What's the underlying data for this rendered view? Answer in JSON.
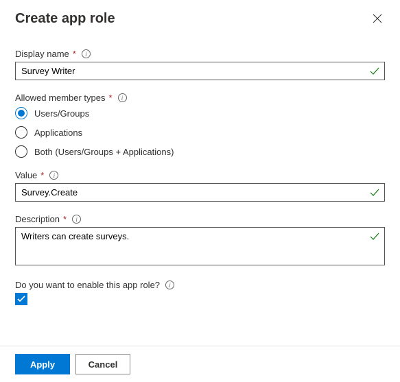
{
  "title": "Create app role",
  "fields": {
    "display_name": {
      "label": "Display name",
      "value": "Survey Writer"
    },
    "allowed_member_types": {
      "label": "Allowed member types",
      "options": [
        "Users/Groups",
        "Applications",
        "Both (Users/Groups + Applications)"
      ],
      "selected_index": 0
    },
    "value": {
      "label": "Value",
      "value": "Survey.Create"
    },
    "description": {
      "label": "Description",
      "value": "Writers can create surveys."
    },
    "enable": {
      "label": "Do you want to enable this app role?",
      "checked": true
    }
  },
  "buttons": {
    "apply": "Apply",
    "cancel": "Cancel"
  }
}
